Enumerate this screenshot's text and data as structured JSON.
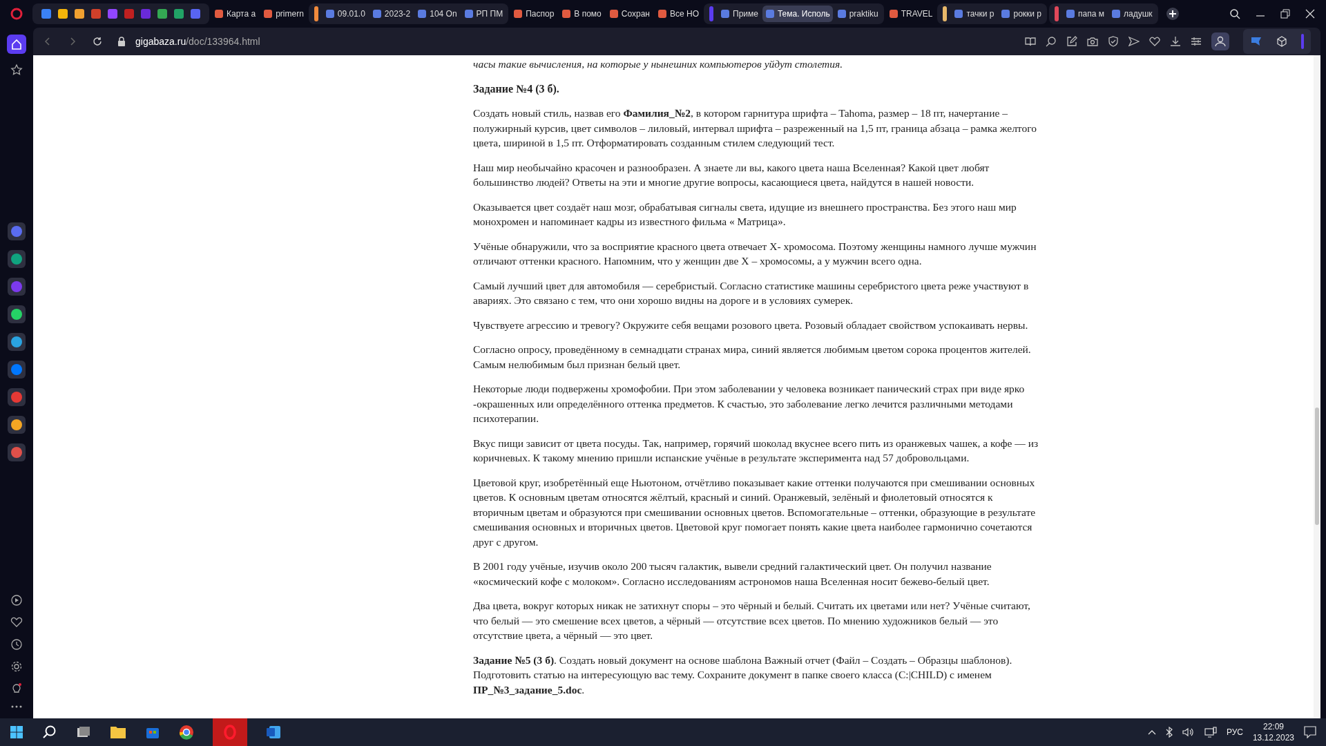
{
  "tab_groups": [
    {
      "kind": "loose",
      "tabs": [
        {
          "label": "Карта а",
          "selected": false
        },
        {
          "label": "primern",
          "selected": false
        }
      ]
    },
    {
      "kind": "group",
      "color": "#f08a3c",
      "tabs": [
        {
          "label": "09.01.0",
          "selected": false
        },
        {
          "label": "2023-2",
          "selected": false
        },
        {
          "label": "104 On",
          "selected": false
        },
        {
          "label": "РП ПМ",
          "selected": false
        }
      ]
    },
    {
      "kind": "loose",
      "tabs": [
        {
          "label": "Паспор",
          "selected": false
        },
        {
          "label": "В помо",
          "selected": false
        },
        {
          "label": "Сохран",
          "selected": false
        },
        {
          "label": "Все НО",
          "selected": false
        }
      ]
    },
    {
      "kind": "group",
      "color": "#5b3cf0",
      "tabs": [
        {
          "label": "Приме",
          "selected": false
        },
        {
          "label": "Тема. Исполь",
          "selected": true
        },
        {
          "label": "praktiku",
          "selected": false
        }
      ]
    },
    {
      "kind": "loose",
      "tabs": [
        {
          "label": "TRAVEL",
          "selected": false
        }
      ]
    },
    {
      "kind": "group",
      "color": "#e8b86a",
      "tabs": [
        {
          "label": "тачки р",
          "selected": false
        },
        {
          "label": "рокки р",
          "selected": false
        }
      ]
    },
    {
      "kind": "group",
      "color": "#e0485a",
      "tabs": [
        {
          "label": "папа м",
          "selected": false
        },
        {
          "label": "ладушк",
          "selected": false
        }
      ]
    }
  ],
  "address_bar": {
    "host": "gigabaza.ru",
    "path": "/doc/133964.html"
  },
  "article": [
    {
      "kind": "italic",
      "text": "часы такие вычисления, на которые у нынешних компьютеров уйдут столетия."
    },
    {
      "kind": "heading",
      "text": "Задание №4 (3 б)."
    },
    {
      "kind": "text",
      "text": "Создать новый стиль, назвав его **Фамилия_№2**, в котором гарнитура шрифта – Tahoma, размер – 18 пт, начертание – полужирный курсив, цвет символов – лиловый, интервал шрифта – разреженный на 1,5 пт, граница абзаца – рамка желтого цвета, шириной в 1,5 пт. Отформатировать созданным стилем следующий тест."
    },
    {
      "kind": "text",
      "text": "Наш мир необычайно красочен и разнообразен. А знаете ли вы, какого цвета наша Вселенная? Какой цвет любят большинство людей? Ответы на эти и многие другие вопросы, касающиеся цвета, найдутся в нашей новости."
    },
    {
      "kind": "text",
      "text": "Оказывается цвет создаёт наш мозг, обрабатывая сигналы света, идущие из внешнего пространства. Без этого наш мир монохромен и напоминает кадры из известного фильма « Матрица»."
    },
    {
      "kind": "text",
      "text": "Учёные обнаружили, что за восприятие красного цвета отвечает Х- хромосома. Поэтому женщины намного лучше мужчин отличают оттенки красного. Напомним, что у женщин две Х – хромосомы, а у мужчин всего одна."
    },
    {
      "kind": "text",
      "text": "Самый лучший цвет для автомобиля — серебристый. Согласно статистике машины серебристого цвета реже участвуют в авариях. Это связано с тем, что они хорошо видны на дороге и в условиях сумерек."
    },
    {
      "kind": "text",
      "text": "Чувствуете агрессию и тревогу? Окружите себя вещами розового цвета. Розовый обладает свойством успокаивать нервы."
    },
    {
      "kind": "text",
      "text": "Согласно опросу, проведённому в семнадцати странах мира, синий является любимым цветом сорока процентов жителей. Самым нелюбимым был признан белый цвет."
    },
    {
      "kind": "text",
      "text": "Некоторые люди подвержены хромофобии. При этом заболевании у человека возникает панический страх при виде ярко -окрашенных или определённого оттенка предметов. К счастью, это заболевание легко лечится различными методами психотерапии."
    },
    {
      "kind": "text",
      "text": "Вкус пищи зависит от цвета посуды. Так, например, горячий шоколад вкуснее всего пить из оранжевых чашек, а кофе — из коричневых. К такому мнению пришли испанские учёные в результате эксперимента над 57 добровольцами."
    },
    {
      "kind": "text",
      "text": "Цветовой круг, изобретённый еще Ньютоном, отчётливо показывает какие оттенки получаются при смешивании основных цветов. К основным цветам относятся жёлтый, красный и синий. Оранжевый, зелёный и фиолетовый относятся к вторичным цветам и образуются при смешивании основных цветов. Вспомогательные – оттенки, образующие в результате смешивания основных и вторичных цветов. Цветовой круг помогает понять какие цвета наиболее гармонично сочетаются друг с другом."
    },
    {
      "kind": "text",
      "text": "В 2001 году учёные, изучив около 200 тысяч галактик, вывели средний галактический цвет. Он получил название «космический кофе с молоком». Согласно исследованиям астрономов наша Вселенная носит бежево-белый цвет."
    },
    {
      "kind": "text",
      "text": "Два цвета, вокруг которых никак не затихнут споры – это чёрный и белый. Считать их цветами или нет? Учёные считают, что белый — это смешение всех цветов, а чёрный — отсутствие всех цветов. По мнению художников белый — это отсутствие цвета, а чёрный — это цвет."
    },
    {
      "kind": "text",
      "text": "**Задание №5 (3 б)**. Создать новый документ на основе шаблона Важный отчет (Файл – Создать – Образцы шаблонов). Подготовить статью на интересующую вас тему. Сохраните документ в папке своего класса (C:|CHILD) с именем **ПР_№3_задание_5.doc**."
    }
  ],
  "tray": {
    "language": "РУС",
    "time": "22:09",
    "date": "13.12.2023"
  }
}
